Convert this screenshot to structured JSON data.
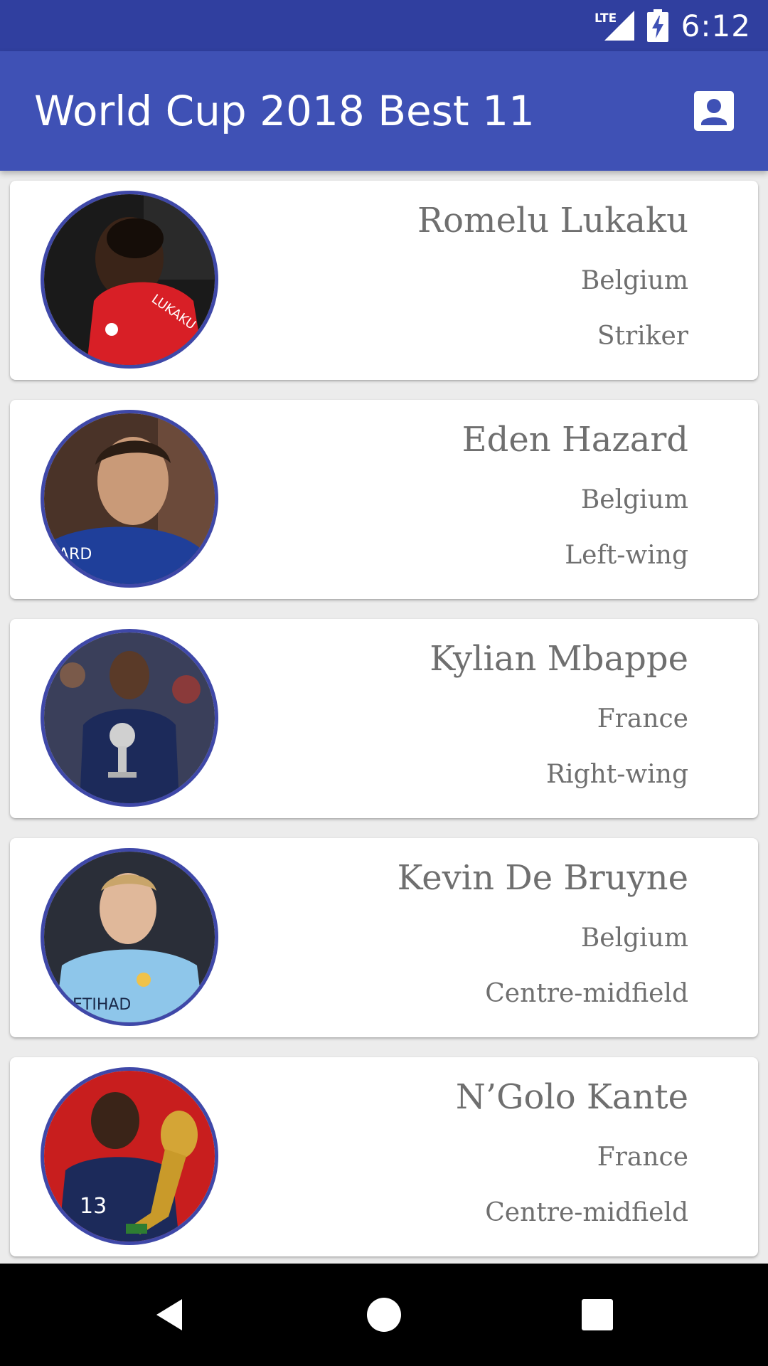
{
  "status_bar": {
    "time": "6:12",
    "network": "LTE",
    "icons": [
      "lte-signal-icon",
      "battery-charging-icon"
    ]
  },
  "app_bar": {
    "title": "World Cup 2018 Best 11",
    "action_icon": "account-box-icon"
  },
  "colors": {
    "primary": "#3f51b5",
    "primary_dark": "#303f9f",
    "avatar_border": "#3f48a8",
    "text_secondary": "#6f6f6f"
  },
  "players": [
    {
      "name": "Romelu Lukaku",
      "country": "Belgium",
      "position": "Striker",
      "avatar": "player-photo-lukaku"
    },
    {
      "name": "Eden Hazard",
      "country": "Belgium",
      "position": "Left-wing",
      "avatar": "player-photo-hazard"
    },
    {
      "name": "Kylian Mbappe",
      "country": "France",
      "position": "Right-wing",
      "avatar": "player-photo-mbappe"
    },
    {
      "name": "Kevin De Bruyne",
      "country": "Belgium",
      "position": "Centre-midfield",
      "avatar": "player-photo-de-bruyne"
    },
    {
      "name": "N’Golo Kante",
      "country": "France",
      "position": "Centre-midfield",
      "avatar": "player-photo-kante"
    }
  ],
  "nav_bar": {
    "icons": [
      "back-icon",
      "home-icon",
      "recents-icon"
    ]
  }
}
